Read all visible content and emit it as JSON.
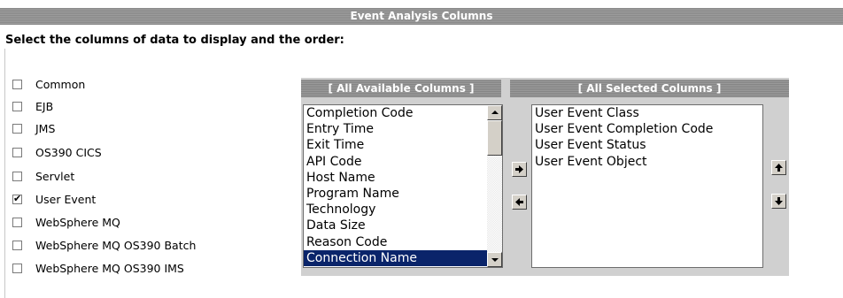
{
  "page": {
    "title": "Event Analysis Columns",
    "instructions": "Select the columns of data to display and the order:"
  },
  "categories": [
    {
      "label": "Common",
      "checked": false
    },
    {
      "label": "EJB",
      "checked": false
    },
    {
      "label": "JMS",
      "checked": false
    },
    {
      "label": "OS390 CICS",
      "checked": false
    },
    {
      "label": "Servlet",
      "checked": false
    },
    {
      "label": "User Event",
      "checked": true
    },
    {
      "label": "WebSphere MQ",
      "checked": false
    },
    {
      "label": "WebSphere MQ OS390 Batch",
      "checked": false
    },
    {
      "label": "WebSphere MQ OS390 IMS",
      "checked": false
    }
  ],
  "available": {
    "header": "[ All Available Columns ]",
    "items": [
      "Completion Code",
      "Entry Time",
      "Exit Time",
      "API Code",
      "Host Name",
      "Program Name",
      "Technology",
      "Data Size",
      "Reason Code",
      "Connection Name"
    ],
    "selected_item": "Connection Name"
  },
  "selected": {
    "header": "[ All Selected Columns ]",
    "items": [
      "User Event Class",
      "User Event Completion Code",
      "User Event Status",
      "User Event Object"
    ]
  },
  "buttons": {
    "add_icon": "arrow-right-icon",
    "remove_icon": "arrow-left-icon",
    "move_up_icon": "arrow-up-icon",
    "move_down_icon": "arrow-down-icon"
  }
}
